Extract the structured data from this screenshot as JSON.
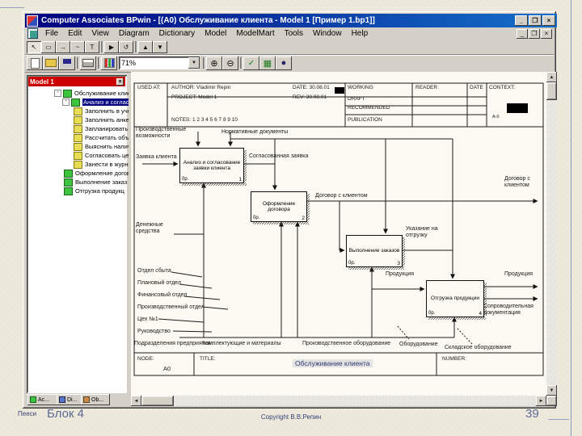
{
  "slide": {
    "footer_left": "Пееси",
    "footer_block": "Блок 4",
    "footer_copyright": "Copyright В.В.Репин",
    "footer_page": "39"
  },
  "titlebar": {
    "title": "Computer Associates BPwin - [(A0) Обслуживание клиента - Model 1 [Пример 1.bp1]]",
    "minimize": "_",
    "restore": "❐",
    "close": "×"
  },
  "menubar": {
    "items": [
      "File",
      "Edit",
      "View",
      "Diagram",
      "Dictionary",
      "Model",
      "ModelMart",
      "Tools",
      "Window",
      "Help"
    ],
    "minimize": "_",
    "restore": "❐",
    "close": "×"
  },
  "toolbar_tools": {
    "pointer": "↖",
    "activity": "▭",
    "arrow": "→",
    "squiggle": "~",
    "text": "T",
    "play": "▶",
    "undo": "↺",
    "up": "▲",
    "down": "▼"
  },
  "toolbar_main": {
    "zoom_value": "71%",
    "dropdown_arrow": "▼",
    "zoom_in": "⊕",
    "zoom_out": "⊖",
    "check": "✓",
    "table": "▦",
    "globe": "●"
  },
  "scroll": {
    "up": "▲",
    "down": "▼",
    "left": "◄",
    "right": "►"
  },
  "explorer": {
    "header": "Model 1",
    "close": "×",
    "tree": [
      {
        "exp": "-",
        "label": "Обслуживание клиента"
      },
      {
        "exp": "-",
        "label": "Анализ и согласован"
      },
      {
        "exp": "",
        "label": "Заполнить в учет"
      },
      {
        "exp": "",
        "label": "Заполнить анкет"
      },
      {
        "exp": "",
        "label": "Запланировать в"
      },
      {
        "exp": "",
        "label": "Рассчитать объе"
      },
      {
        "exp": "",
        "label": "Выяснить наличи"
      },
      {
        "exp": "",
        "label": "Согласовать цен"
      },
      {
        "exp": "",
        "label": "Занести в журна"
      },
      {
        "exp": "",
        "label": "Оформление догов"
      },
      {
        "exp": "",
        "label": "Выполнение заказ"
      },
      {
        "exp": "",
        "label": "Отгрузка продукц"
      }
    ],
    "tabs": [
      "Ac...",
      "Di...",
      "Ob..."
    ]
  },
  "kit": {
    "used_at": "USED AT:",
    "author": "AUTHOR:  Vladimir Repin",
    "date": "DATE: 30.08.01",
    "rev": "REV:  30.08.01",
    "project": "PROJECT:  Model 1",
    "notes": "NOTES:  1  2  3  4  5  6  7  8  9  10",
    "working": "WORKING",
    "draft": "DRAFT",
    "recommended": "RECOMMENDED",
    "publication": "PUBLICATION",
    "reader": "READER",
    "date2": "DATE",
    "context": "CONTEXT:",
    "context_node": "A-0",
    "node_label": "NODE:",
    "node": "A0",
    "title_label": "TITLE:",
    "title": "Обслуживание клиента",
    "number_label": "NUMBER:"
  },
  "boxes": [
    {
      "name": "Анализ и согласование заявки клиента",
      "cost": "0р.",
      "number": "1"
    },
    {
      "name": "Оформление договора",
      "cost": "0р.",
      "number": "2"
    },
    {
      "name": "Выполнение заказов",
      "cost": "0р.",
      "number": "3"
    },
    {
      "name": "Отгрузка продукции",
      "cost": "0р.",
      "number": "4"
    }
  ],
  "labels": {
    "production_capabilities": "Производственные возможности",
    "normative_docs": "Нормативные документы",
    "client_request": "Заявка клиента",
    "agreed_request": "Согласованная заявка",
    "contract": "Договор с клиентом",
    "contract_right": "Договор с клиентом",
    "shipping_instruction": "Указание на отгрузку",
    "products_mid": "Продукция",
    "products_right": "Продукция",
    "accompanying_docs": "Сопроводительная документация",
    "money": "Денежные средства",
    "sales_dept": "Отдел сбыта",
    "planning_dept": "Плановый отдел",
    "finance_dept": "Финансовый отдел",
    "production_dept": "Производственный отдел",
    "workshop": "Цех №1",
    "management": "Руководство",
    "depts": "Подразделения предприятия",
    "materials": "Комплектующие и материалы",
    "production_equipment": "Производственное оборудование",
    "equipment": "Оборудование",
    "warehouse_equipment": "Складское оборудование"
  },
  "colors": {
    "titlebar": "#000080",
    "titlebar_gradient": "#1470c8",
    "chrome": "#d4d0c8",
    "explorer_header": "#cc0000",
    "selection": "#000080",
    "canvas": "#fbf9f1",
    "slide_bg": "#f2eddb"
  }
}
